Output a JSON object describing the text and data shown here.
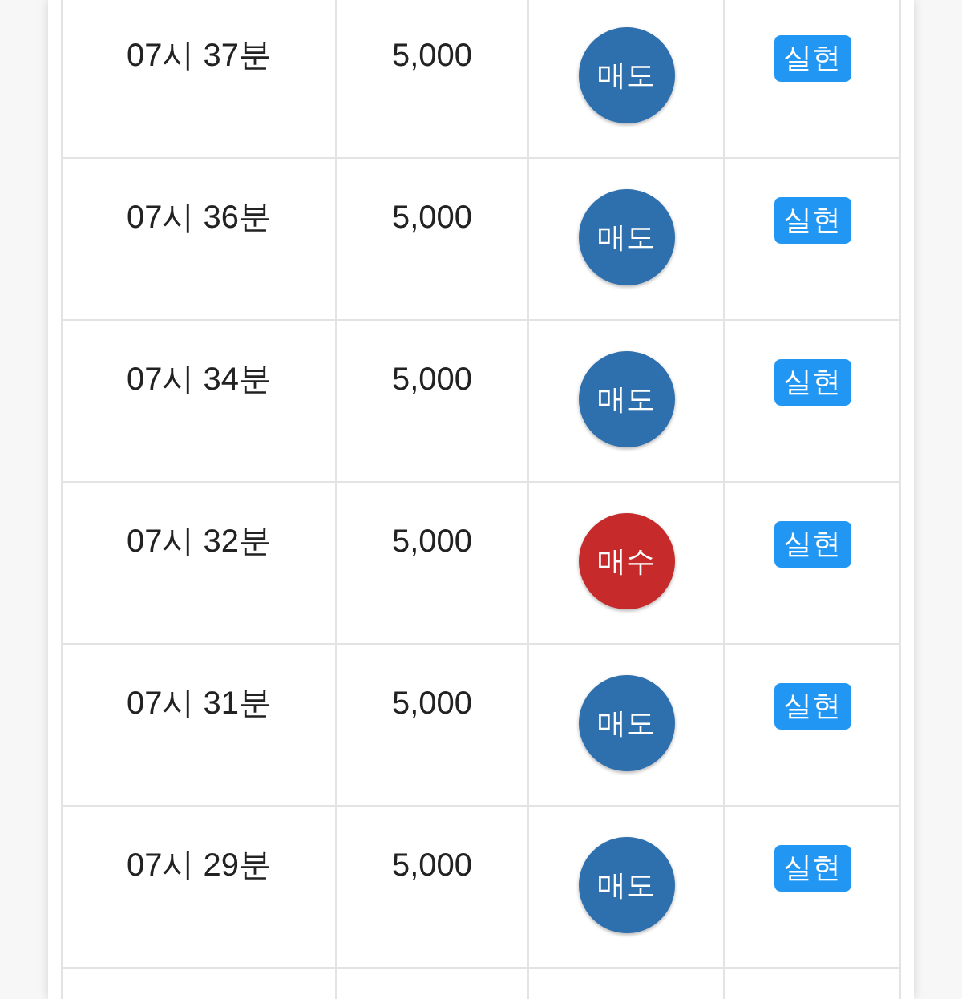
{
  "rows": [
    {
      "time": "07시 37분",
      "amount": "5,000",
      "side": {
        "label": "매도",
        "kind": "sell"
      },
      "result": "실현"
    },
    {
      "time": "07시 36분",
      "amount": "5,000",
      "side": {
        "label": "매도",
        "kind": "sell"
      },
      "result": "실현"
    },
    {
      "time": "07시 34분",
      "amount": "5,000",
      "side": {
        "label": "매도",
        "kind": "sell"
      },
      "result": "실현"
    },
    {
      "time": "07시 32분",
      "amount": "5,000",
      "side": {
        "label": "매수",
        "kind": "buy"
      },
      "result": "실현"
    },
    {
      "time": "07시 31분",
      "amount": "5,000",
      "side": {
        "label": "매도",
        "kind": "sell"
      },
      "result": "실현"
    },
    {
      "time": "07시 29분",
      "amount": "5,000",
      "side": {
        "label": "매도",
        "kind": "sell"
      },
      "result": "실현"
    }
  ]
}
